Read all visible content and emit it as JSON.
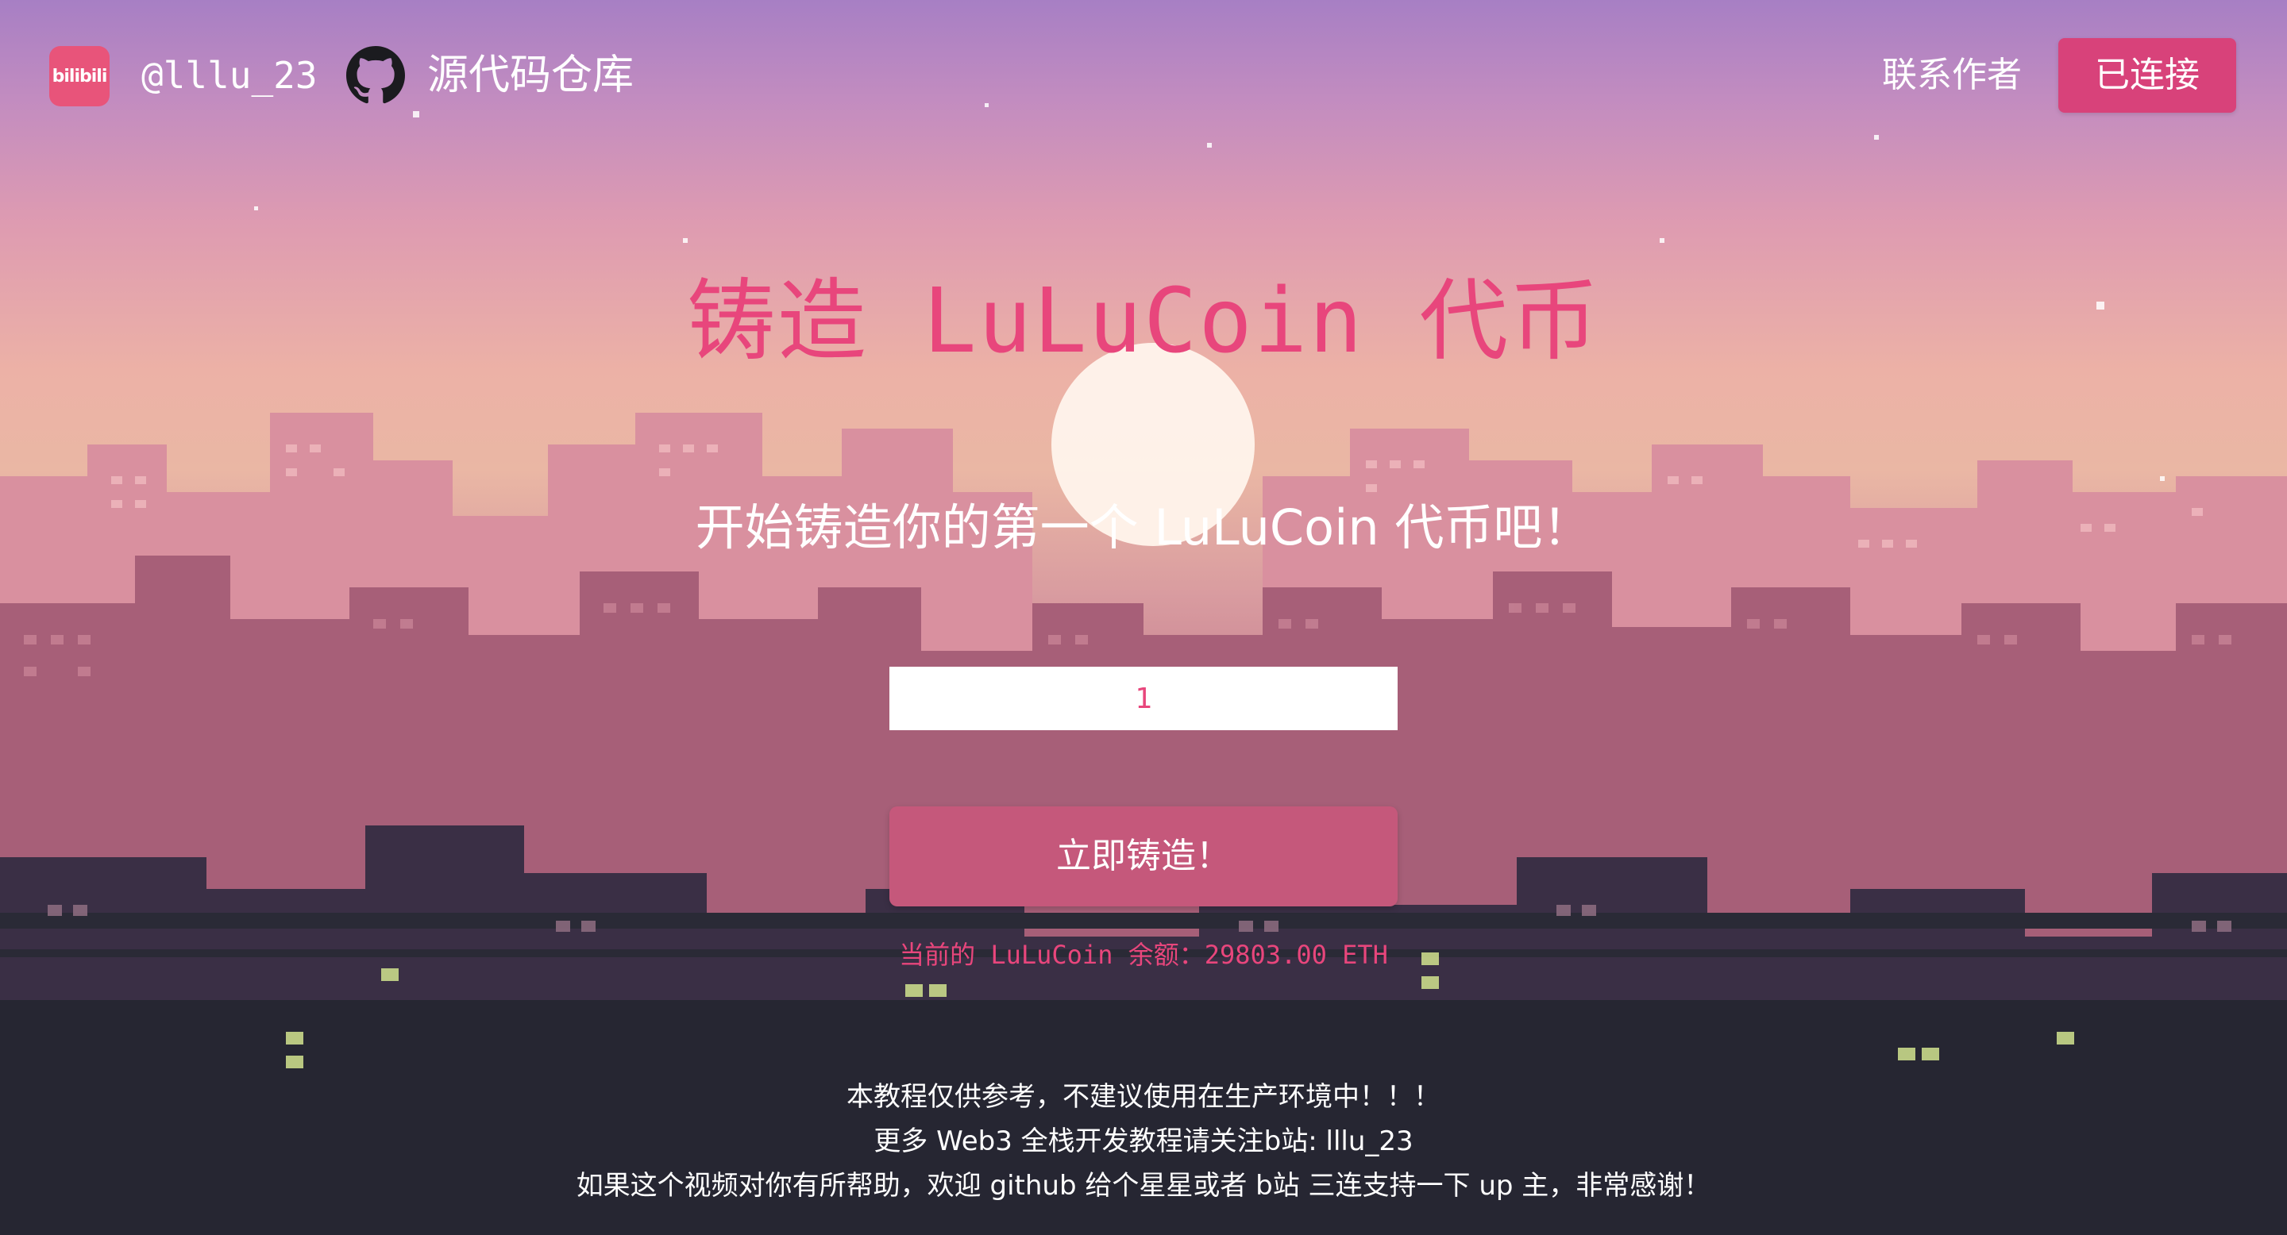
{
  "nav": {
    "logo_text": "bilibili",
    "handle": "@lllu_23",
    "repo_label": "源代码仓库",
    "contact_label": "联系作者",
    "connect_label": "已连接"
  },
  "hero": {
    "title": "铸造 LuLuCoin 代币",
    "subtitle": "开始铸造你的第一个 LuLuCoin 代币吧！"
  },
  "form": {
    "amount_value": "1",
    "mint_label": "立即铸造！",
    "balance_text": "当前的 LuLuCoin 余额：29803.00 ETH"
  },
  "footer": {
    "line1": "本教程仅供参考，不建议使用在生产环境中！！！",
    "line2": "更多 Web3 全栈开发教程请关注b站: lllu_23",
    "line3": "如果这个视频对你有所帮助，欢迎 github 给个星星或者 b站 三连支持一下 up 主，非常感谢！"
  },
  "colors": {
    "accent_pink": "#e8467c",
    "button_pink": "#c5587b",
    "connect_pink": "#d8427a"
  }
}
